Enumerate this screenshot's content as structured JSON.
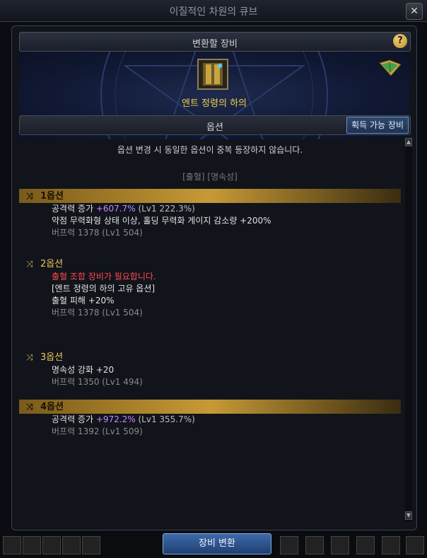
{
  "window": {
    "title": "이질적인 차원의 큐브",
    "close_icon": "close-icon"
  },
  "header": {
    "title": "변환할 장비",
    "help_label": "?"
  },
  "item": {
    "name": "엔트 정령의 하의",
    "icon": "pants-item-icon"
  },
  "options_bar": {
    "title": "옵션",
    "obtain_button": "획득 가능 장비"
  },
  "notice": "옵션 변경 시 동일한 옵션이 중복 등장하지 않습니다.",
  "tags": "[출혈] [명속성]",
  "options": [
    {
      "label": "1옵션",
      "highlighted": true,
      "lines": [
        {
          "prefix": "공격력 증가 ",
          "value": "+607.7%",
          "suffix": "  (Lv1  222.3%)"
        },
        {
          "text": "약점 무력화형 상태 이상, 홀딩 무력화 게이지 감소량 +200%"
        },
        {
          "text": "버프력 1378 (Lv1 504)",
          "style": "dim"
        }
      ]
    },
    {
      "label": "2옵션",
      "highlighted": false,
      "lines": [
        {
          "text": "출혈 조합 장비가 필요합니다.",
          "style": "red"
        },
        {
          "text": "[엔트 정령의 하의 고유 옵션]"
        },
        {
          "text": "출혈 피해 +20%"
        },
        {
          "text": "버프력 1378 (Lv1 504)",
          "style": "dim"
        }
      ]
    },
    {
      "label": "3옵션",
      "highlighted": false,
      "lines": [
        {
          "text": "명속성 강화 +20"
        },
        {
          "text": "버프력 1350 (Lv1 494)",
          "style": "dim"
        }
      ]
    },
    {
      "label": "4옵션",
      "highlighted": true,
      "lines": [
        {
          "prefix": "공격력 증가 ",
          "value": "+972.2%",
          "suffix": "  (Lv1  355.7%)"
        },
        {
          "text": "버프력 1392 (Lv1 509)",
          "style": "dim"
        }
      ]
    }
  ],
  "footer": {
    "convert_button": "장비 변환"
  },
  "colors": {
    "gold": "#e6c45a",
    "purple": "#c28cff",
    "red": "#ff4a4a",
    "accent_button": "#2f5a96"
  }
}
